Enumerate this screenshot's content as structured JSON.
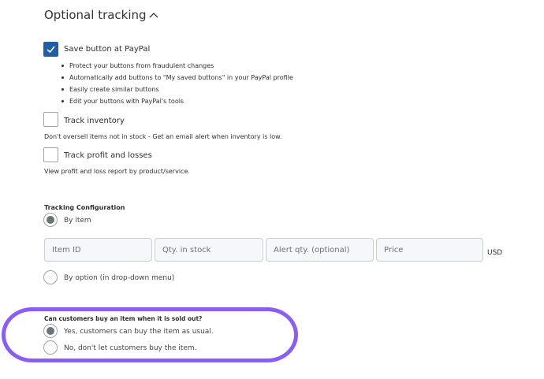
{
  "section": {
    "title": "Optional tracking"
  },
  "save_button": {
    "label": "Save button at PayPal",
    "checked": true,
    "bullets": [
      "Protect your buttons from fraudulent changes",
      "Automatically add buttons to \"My saved buttons\" in your PayPal profile",
      "Easily create similar buttons",
      "Edit your buttons with PayPal's tools"
    ]
  },
  "track_inventory": {
    "label": "Track inventory",
    "checked": false,
    "help": "Don't oversell items not in stock - Get an email alert when inventory is low."
  },
  "track_profit": {
    "label": "Track profit and losses",
    "checked": false,
    "help": "View profit and loss report by product/service."
  },
  "tracking_config": {
    "title": "Tracking Configuration",
    "by_item": {
      "label": "By item",
      "selected": true
    },
    "fields": [
      {
        "placeholder": "Item ID"
      },
      {
        "placeholder": "Qty. in stock"
      },
      {
        "placeholder": "Alert qty. (optional)"
      },
      {
        "placeholder": "Price"
      }
    ],
    "currency": "USD",
    "by_option": {
      "label": "By option (in drop-down menu)",
      "selected": false
    }
  },
  "sold_out": {
    "question": "Can customers buy an item when it is sold out?",
    "options": [
      {
        "label": "Yes, customers can buy the item as usual.",
        "selected": true
      },
      {
        "label": "No, don't let customers buy the item.",
        "selected": false
      }
    ]
  },
  "colors": {
    "checkbox_checked": "#1f5fa8",
    "highlight": "#8b5cf6",
    "radio_dot": "#6c7378"
  }
}
